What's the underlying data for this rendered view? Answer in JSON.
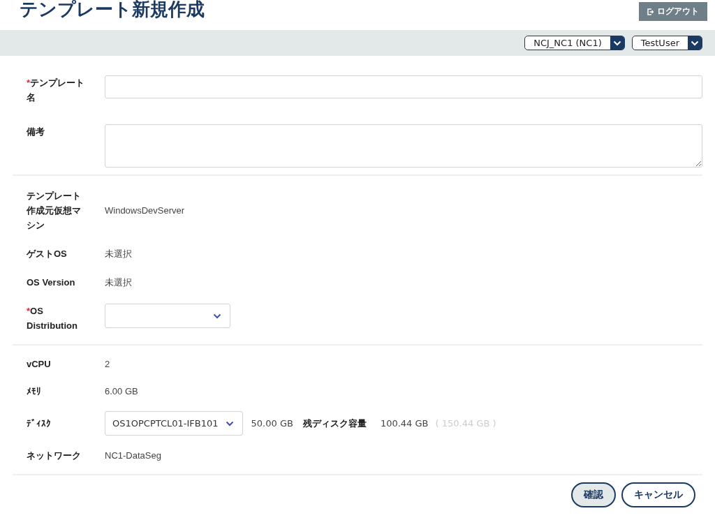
{
  "title": "テンプレート新規作成",
  "logout_button": "ログアウト",
  "header_selects": [
    {
      "value": "NCJ_NC1 (NC1)"
    },
    {
      "value": "TestUser"
    }
  ],
  "sections": [
    {
      "fields": [
        {
          "kind": "input",
          "required_mark": "*",
          "label": "テンプレート名"
        },
        {
          "kind": "textarea",
          "label": "備考"
        }
      ]
    },
    {
      "fields": [
        {
          "kind": "text",
          "label": "テンプレート作成元仮想マシン",
          "value": "WindowsDevServer"
        },
        {
          "kind": "text",
          "label": "ゲストOS",
          "value": "未選択"
        },
        {
          "kind": "text",
          "label": "OS Version",
          "value": "未選択"
        },
        {
          "kind": "select",
          "required_mark": "*",
          "label": "OS Distribution"
        }
      ]
    },
    {
      "fields": [
        {
          "kind": "text",
          "label": "vCPU",
          "value": "2"
        },
        {
          "kind": "text",
          "label": "ﾒﾓﾘ",
          "value": "6.00 GB"
        },
        {
          "kind": "disk",
          "label": "ﾃﾞｨｽｸ",
          "value": "OS1OPCPTCL01-IFB101",
          "size": "50.00 GB",
          "remaining_label": "残ディスク容量",
          "remaining": "100.44 GB",
          "total": "( 150.44 GB )"
        },
        {
          "kind": "text",
          "label": "ネットワーク",
          "value": "NC1-DataSeg"
        }
      ]
    }
  ],
  "buttons": [
    {
      "kind": "primary",
      "label": "確認"
    },
    {
      "kind": "secondary",
      "label": "キャンセル"
    }
  ]
}
